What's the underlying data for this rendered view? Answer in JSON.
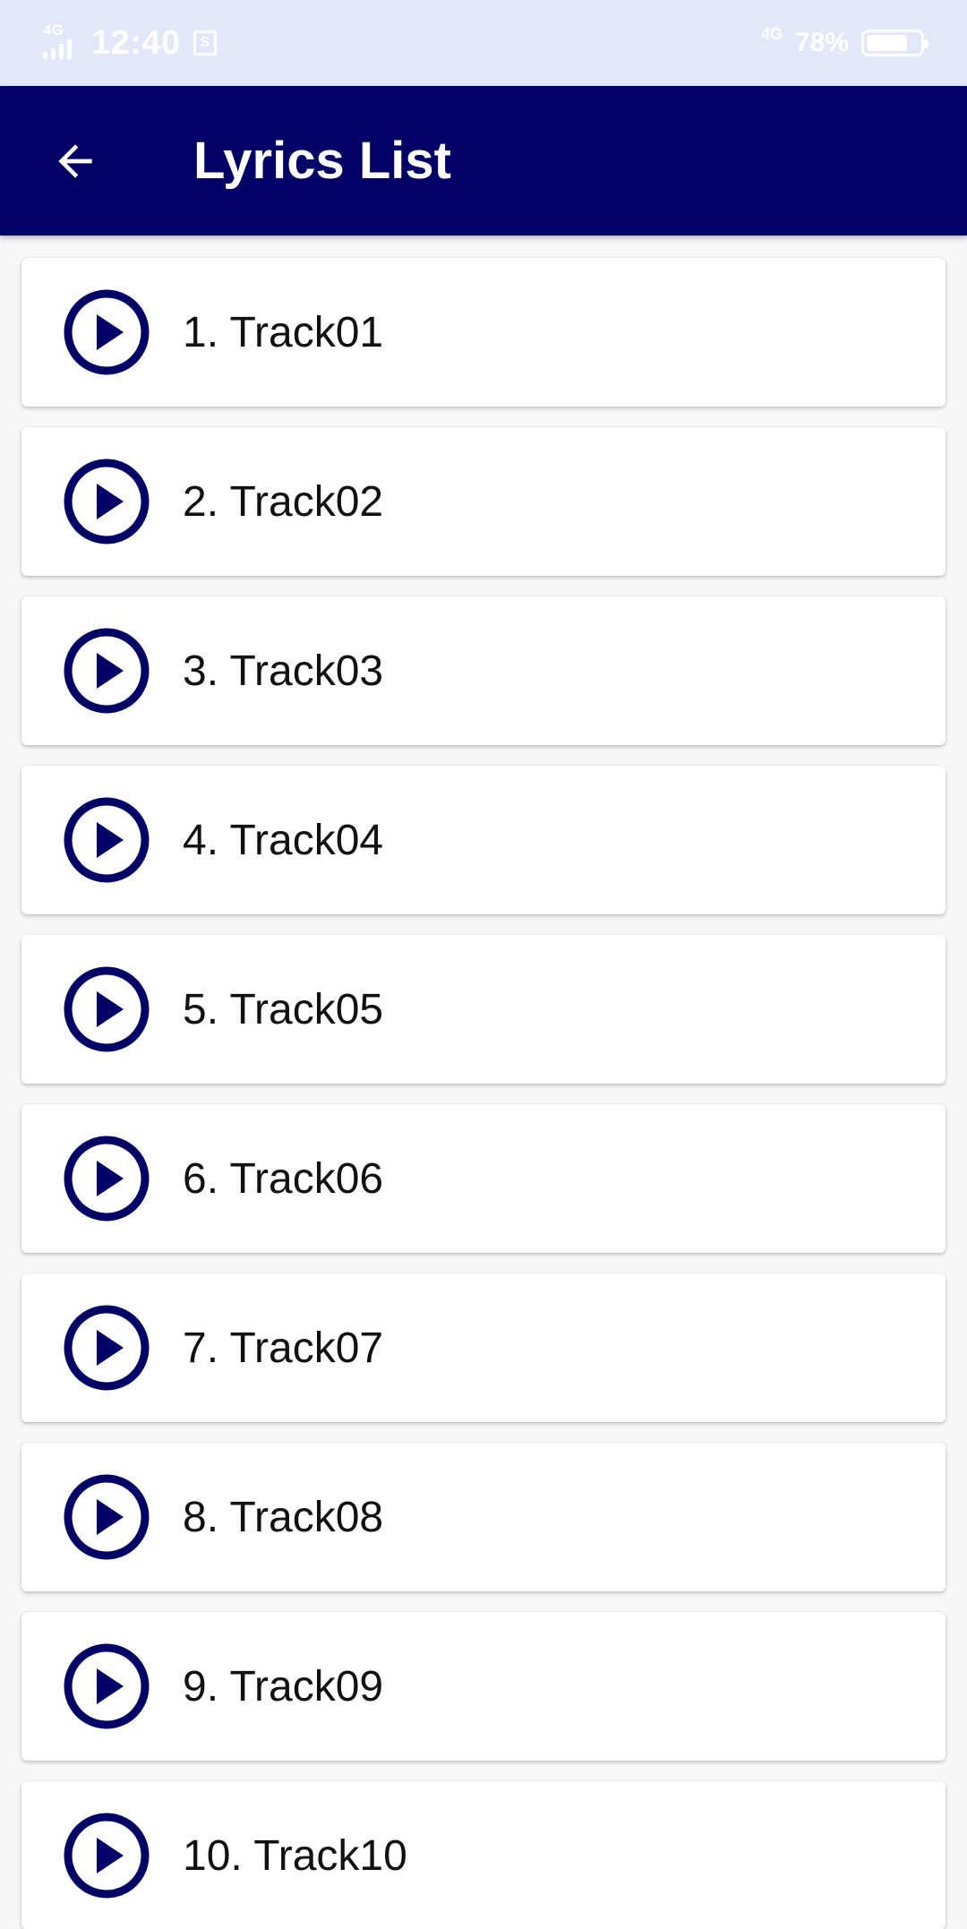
{
  "status_bar": {
    "network_left": "4G",
    "time": "12:40",
    "s_badge": "S",
    "network_right": "4G",
    "battery_percent": "78%",
    "battery_level": 0.78
  },
  "app_bar": {
    "title": "Lyrics List",
    "background": "#000066"
  },
  "accent_color": "#000066",
  "tracks": [
    {
      "label": "1. Track01"
    },
    {
      "label": "2. Track02"
    },
    {
      "label": "3. Track03"
    },
    {
      "label": "4. Track04"
    },
    {
      "label": "5. Track05"
    },
    {
      "label": "6. Track06"
    },
    {
      "label": "7. Track07"
    },
    {
      "label": "8. Track08"
    },
    {
      "label": "9. Track09"
    },
    {
      "label": "10. Track10"
    }
  ]
}
